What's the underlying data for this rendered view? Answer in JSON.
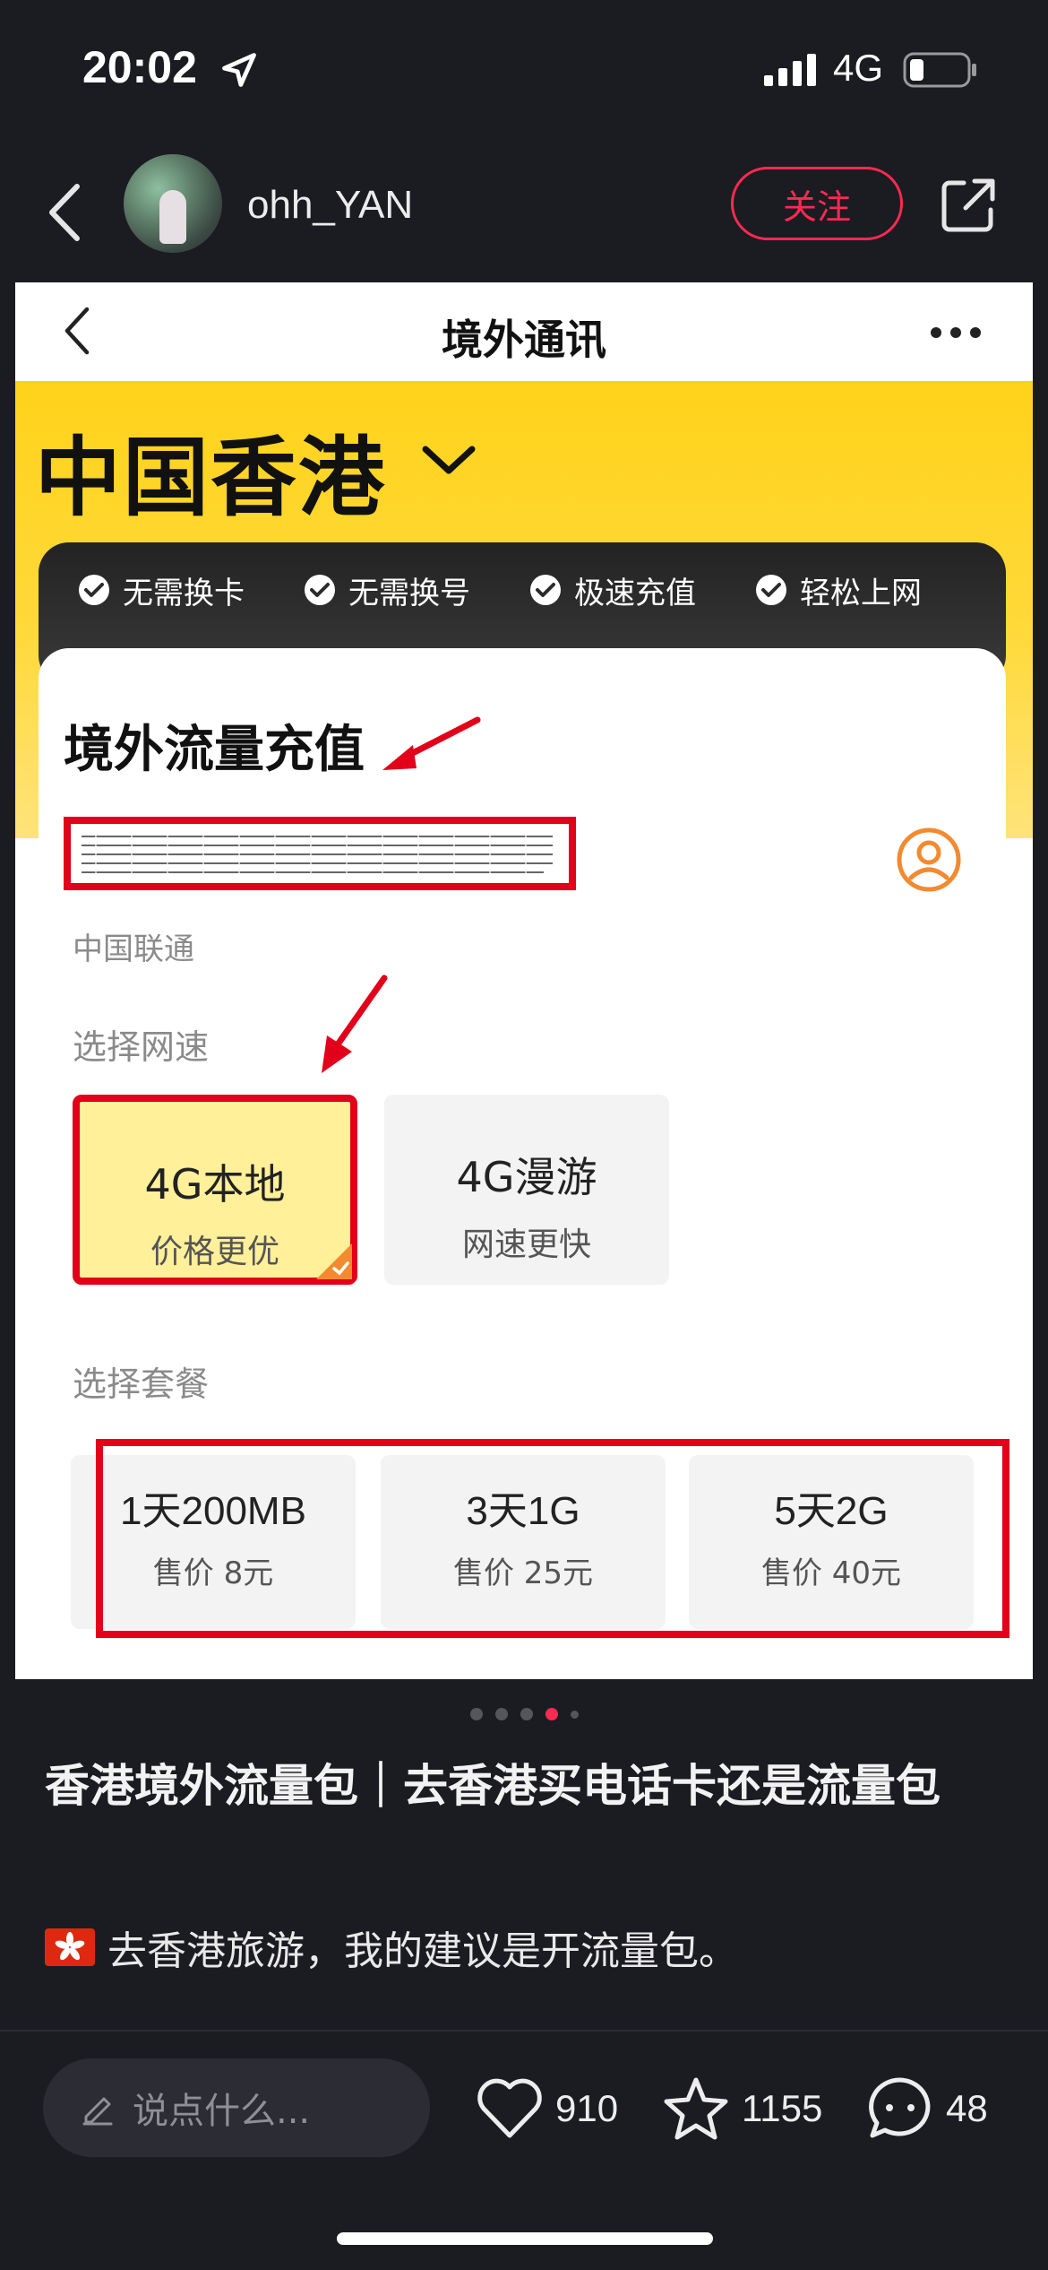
{
  "status_bar": {
    "time": "20:02",
    "network": "4G",
    "battery_level": 0.25
  },
  "post_header": {
    "username": "ohh_YAN",
    "follow_label": "关注"
  },
  "screenshot": {
    "nav_title": "境外通讯",
    "region": "中国香港",
    "features": [
      "无需换卡",
      "无需换号",
      "极速充值",
      "轻松上网"
    ],
    "card_heading": "境外流量充值",
    "carrier": "中国联通",
    "speed_label": "选择网速",
    "speed_options": [
      {
        "title": "4G本地",
        "subtitle": "价格更优",
        "selected": true
      },
      {
        "title": "4G漫游",
        "subtitle": "网速更快",
        "selected": false
      }
    ],
    "package_label": "选择套餐",
    "packages": [
      {
        "title": "1天200MB",
        "price": "售价 8元"
      },
      {
        "title": "3天1G",
        "price": "售价 25元"
      },
      {
        "title": "5天2G",
        "price": "售价 40元"
      }
    ],
    "colors": {
      "accent_yellow": "#ffd21a",
      "highlight_red": "#e2001a"
    }
  },
  "carousel": {
    "count": 5,
    "active_index": 3
  },
  "post": {
    "title": "香港境外流量包｜去香港买电话卡还是流量包",
    "body": "去香港旅游，我的建议是开流量包。"
  },
  "bottom_bar": {
    "comment_placeholder": "说点什么...",
    "likes": "910",
    "favorites": "1155",
    "comments": "48"
  },
  "colors": {
    "background": "#1b1b22",
    "brand_red": "#ff2a4f"
  }
}
